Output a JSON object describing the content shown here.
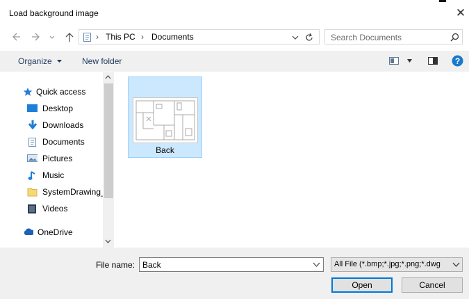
{
  "window": {
    "title": "Load background image",
    "close_glyph": "✕"
  },
  "address": {
    "back_icon": "back-arrow-icon",
    "forward_icon": "forward-arrow-icon",
    "up_icon": "up-arrow-icon",
    "breadcrumb": [
      "This PC",
      "Documents"
    ],
    "search_placeholder": "Search Documents"
  },
  "toolbar": {
    "organize_label": "Organize",
    "new_folder_label": "New folder"
  },
  "nav": {
    "items": [
      {
        "label": "Quick access",
        "icon": "star-icon"
      },
      {
        "label": "Desktop",
        "icon": "desktop-icon",
        "pinned": true
      },
      {
        "label": "Downloads",
        "icon": "download-icon",
        "pinned": true
      },
      {
        "label": "Documents",
        "icon": "documents-icon",
        "pinned": true
      },
      {
        "label": "Pictures",
        "icon": "pictures-icon",
        "pinned": true
      },
      {
        "label": "Music",
        "icon": "music-icon"
      },
      {
        "label": "SystemDrawing_",
        "icon": "folder-icon"
      },
      {
        "label": "Videos",
        "icon": "videos-icon"
      },
      {
        "label": "OneDrive",
        "icon": "cloud-icon"
      }
    ]
  },
  "files": [
    {
      "name": "Back",
      "selected": true
    }
  ],
  "bottom": {
    "file_name_label": "File name:",
    "file_name_value": "Back",
    "filter_value": "All File (*.bmp;*.jpg;*.png;*.dwg",
    "open_label": "Open",
    "cancel_label": "Cancel"
  },
  "colors": {
    "selection_fill": "#cce8ff",
    "selection_border": "#99d1ff",
    "accent": "#0078d7"
  }
}
